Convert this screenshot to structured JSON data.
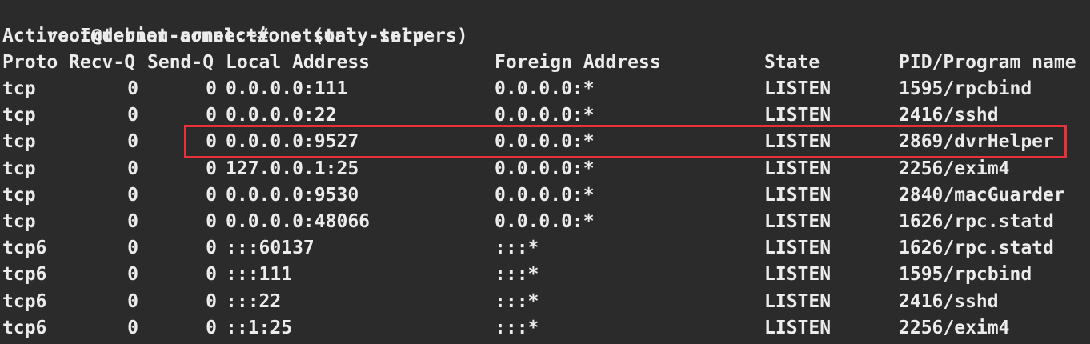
{
  "terminal": {
    "prompt": "root@debian-armel:~# ",
    "command": "netstat -tnlp",
    "subtitle": "Active Internet connections (only servers)",
    "headers": {
      "proto": "Proto",
      "recv_q": "Recv-Q",
      "send_q": "Send-Q",
      "local_address": "Local Address",
      "foreign_address": "Foreign Address",
      "state": "State",
      "program": "PID/Program name"
    },
    "rows": [
      {
        "proto": "tcp",
        "recv_q": "0",
        "send_q": "0",
        "local": "0.0.0.0:111",
        "foreign": "0.0.0.0:*",
        "state": "LISTEN",
        "program": "1595/rpcbind"
      },
      {
        "proto": "tcp",
        "recv_q": "0",
        "send_q": "0",
        "local": "0.0.0.0:22",
        "foreign": "0.0.0.0:*",
        "state": "LISTEN",
        "program": "2416/sshd"
      },
      {
        "proto": "tcp",
        "recv_q": "0",
        "send_q": "0",
        "local": "0.0.0.0:9527",
        "foreign": "0.0.0.0:*",
        "state": "LISTEN",
        "program": "2869/dvrHelper"
      },
      {
        "proto": "tcp",
        "recv_q": "0",
        "send_q": "0",
        "local": "127.0.0.1:25",
        "foreign": "0.0.0.0:*",
        "state": "LISTEN",
        "program": "2256/exim4"
      },
      {
        "proto": "tcp",
        "recv_q": "0",
        "send_q": "0",
        "local": "0.0.0.0:9530",
        "foreign": "0.0.0.0:*",
        "state": "LISTEN",
        "program": "2840/macGuarder"
      },
      {
        "proto": "tcp",
        "recv_q": "0",
        "send_q": "0",
        "local": "0.0.0.0:48066",
        "foreign": "0.0.0.0:*",
        "state": "LISTEN",
        "program": "1626/rpc.statd"
      },
      {
        "proto": "tcp6",
        "recv_q": "0",
        "send_q": "0",
        "local": ":::60137",
        "foreign": ":::*",
        "state": "LISTEN",
        "program": "1626/rpc.statd"
      },
      {
        "proto": "tcp6",
        "recv_q": "0",
        "send_q": "0",
        "local": ":::111",
        "foreign": ":::*",
        "state": "LISTEN",
        "program": "1595/rpcbind"
      },
      {
        "proto": "tcp6",
        "recv_q": "0",
        "send_q": "0",
        "local": ":::22",
        "foreign": ":::*",
        "state": "LISTEN",
        "program": "2416/sshd"
      },
      {
        "proto": "tcp6",
        "recv_q": "0",
        "send_q": "0",
        "local": "::1:25",
        "foreign": ":::*",
        "state": "LISTEN",
        "program": "2256/exim4"
      }
    ],
    "highlighted_row": 2,
    "colors": {
      "background": "#2b2b2b",
      "text": "#ececec",
      "highlight_border": "#e8323a"
    }
  }
}
